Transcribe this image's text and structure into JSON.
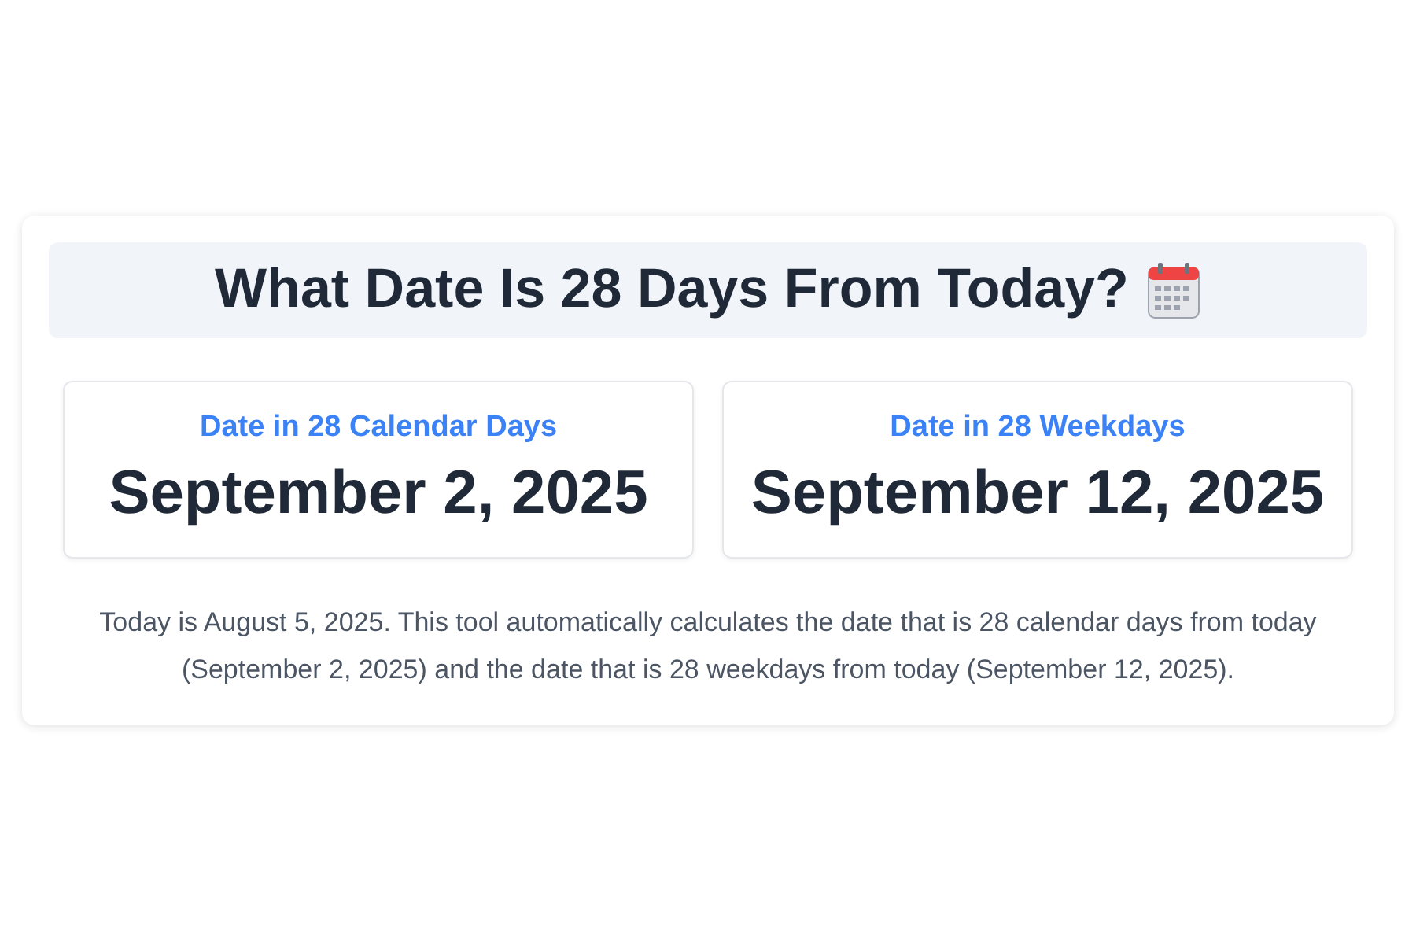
{
  "title": "What Date Is 28 Days From Today?",
  "results": [
    {
      "label": "Date in 28 Calendar Days",
      "date": "September 2, 2025"
    },
    {
      "label": "Date in 28 Weekdays",
      "date": "September 12, 2025"
    }
  ],
  "description": "Today is August 5, 2025. This tool automatically calculates the date that is 28 calendar days from today (September 2, 2025) and the date that is 28 weekdays from today (September 12, 2025)."
}
